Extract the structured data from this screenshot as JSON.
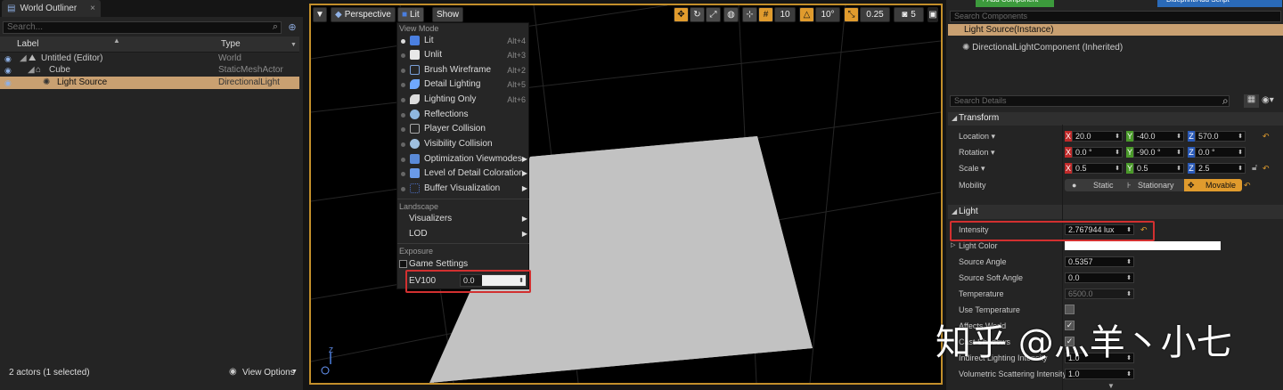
{
  "outliner": {
    "tab_title": "World Outliner",
    "search_placeholder": "Search...",
    "col_label": "Label",
    "col_type": "Type",
    "rows": [
      {
        "label": "Untitled (Editor)",
        "type": "World"
      },
      {
        "label": "Cube",
        "type": "StaticMeshActor"
      },
      {
        "label": "Light Source",
        "type": "DirectionalLight"
      }
    ],
    "status": "2 actors (1 selected)",
    "view_options": "View Options"
  },
  "viewport": {
    "perspective_label": "Perspective",
    "lit_label": "Lit",
    "show_label": "Show",
    "grid_value": "10",
    "rotation_value": "10°",
    "scale_value": "0.25",
    "camera_speed": "5"
  },
  "view_menu": {
    "section_view_mode": "View Mode",
    "items": [
      {
        "label": "Lit",
        "shortcut": "Alt+4",
        "icon": "lit-sphere-icon",
        "color": "#4a7fe0"
      },
      {
        "label": "Unlit",
        "shortcut": "Alt+3",
        "icon": "unlit-shield-icon",
        "color": "#e8e8e8"
      },
      {
        "label": "Brush Wireframe",
        "shortcut": "Alt+2",
        "icon": "wireframe-cube-icon",
        "color": "#7aa0d8"
      },
      {
        "label": "Detail Lighting",
        "shortcut": "Alt+5",
        "icon": "detail-lighting-icon",
        "color": "#6fa8ff"
      },
      {
        "label": "Lighting Only",
        "shortcut": "Alt+6",
        "icon": "lighting-only-icon",
        "color": "#dddddd"
      },
      {
        "label": "Reflections",
        "shortcut": "",
        "icon": "reflections-sphere-icon",
        "color": "#8fb8e0"
      },
      {
        "label": "Player Collision",
        "shortcut": "",
        "icon": "player-collision-icon",
        "color": "#aaaaaa"
      },
      {
        "label": "Visibility Collision",
        "shortcut": "",
        "icon": "visibility-collision-icon",
        "color": "#9fc0e0"
      },
      {
        "label": "Optimization Viewmodes",
        "shortcut": "",
        "icon": "optimization-icon",
        "color": "#5a8ad8"
      },
      {
        "label": "Level of Detail Coloration",
        "shortcut": "",
        "icon": "lod-coloration-icon",
        "color": "#6a9ae8"
      },
      {
        "label": "Buffer Visualization",
        "shortcut": "",
        "icon": "buffer-visualization-icon",
        "color": "#4a6ab8"
      }
    ],
    "section_landscape": "Landscape",
    "visualizers": "Visualizers",
    "lod": "LOD",
    "section_exposure": "Exposure",
    "game_settings": "Game Settings",
    "ev100_label": "EV100",
    "ev100_value": "0.0"
  },
  "components": {
    "add_component_label": "+ Add Component",
    "blueprint_label": "Blueprint/Add Script",
    "search_placeholder": "Search Components",
    "instance_label": "Light Source(Instance)",
    "component_label": "DirectionalLightComponent (Inherited)"
  },
  "details": {
    "search_placeholder": "Search Details",
    "transform_header": "Transform",
    "location_label": "Location",
    "location": [
      "20.0",
      "-40.0",
      "570.0"
    ],
    "rotation_label": "Rotation",
    "rotation": [
      "0.0 °",
      "-90.0 °",
      "0.0 °"
    ],
    "scale_label": "Scale",
    "scale": [
      "0.5",
      "0.5",
      "2.5"
    ],
    "mobility_label": "Mobility",
    "mobility_options": [
      "Static",
      "Stationary",
      "Movable"
    ],
    "light_header": "Light",
    "intensity_label": "Intensity",
    "intensity_value": "2.767944 lux",
    "light_color_label": "Light Color",
    "source_angle_label": "Source Angle",
    "source_angle_value": "0.5357",
    "source_soft_angle_label": "Source Soft Angle",
    "source_soft_angle_value": "0.0",
    "temperature_label": "Temperature",
    "temperature_value": "6500.0",
    "use_temperature_label": "Use Temperature",
    "affects_world_label": "Affects World",
    "cast_shadows_label": "Cast Shadows",
    "indirect_label": "Indirect Lighting Intensity",
    "indirect_value": "1.0",
    "volumetric_label": "Volumetric Scattering Intensity",
    "volumetric_value": "1.0",
    "axis_x": "X",
    "axis_y": "Y",
    "axis_z": "Z"
  },
  "watermark": "知乎 @灬羊丶小七",
  "colors": {
    "accent": "#e09b2d",
    "highlight": "#d23030",
    "selection": "#c9a071"
  }
}
